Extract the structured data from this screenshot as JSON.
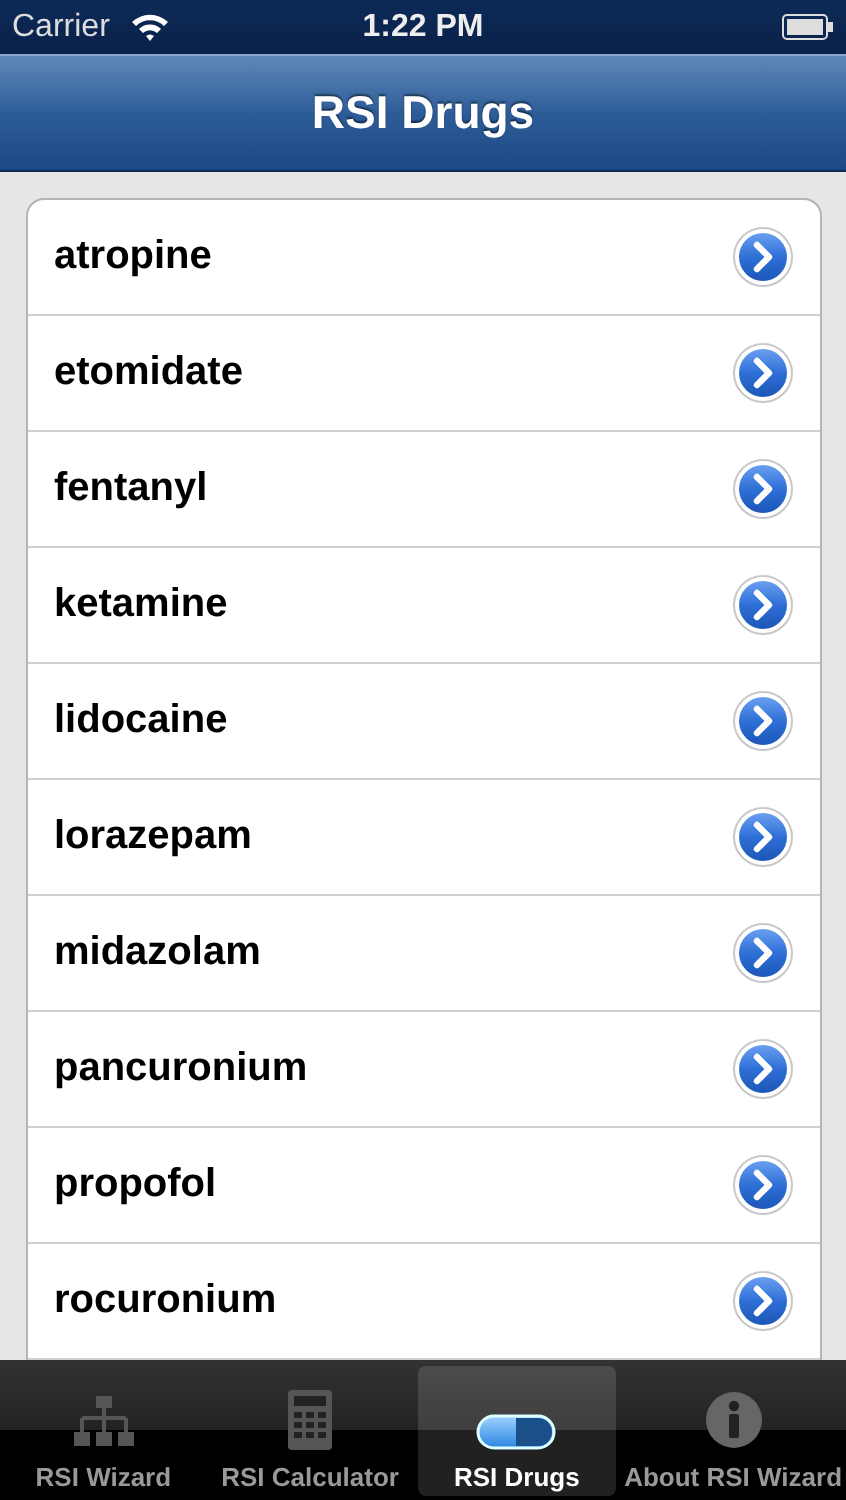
{
  "status_bar": {
    "carrier": "Carrier",
    "time": "1:22 PM"
  },
  "nav_bar": {
    "title": "RSI Drugs"
  },
  "drugs": [
    {
      "name": "atropine"
    },
    {
      "name": "etomidate"
    },
    {
      "name": "fentanyl"
    },
    {
      "name": "ketamine"
    },
    {
      "name": "lidocaine"
    },
    {
      "name": "lorazepam"
    },
    {
      "name": "midazolam"
    },
    {
      "name": "pancuronium"
    },
    {
      "name": "propofol"
    },
    {
      "name": "rocuronium"
    }
  ],
  "tab_bar": [
    {
      "label": "RSI Wizard",
      "kind": "hierarchy",
      "selected": false
    },
    {
      "label": "RSI Calculator",
      "kind": "calculator",
      "selected": false
    },
    {
      "label": "RSI Drugs",
      "kind": "pill",
      "selected": true
    },
    {
      "label": "About RSI Wizard",
      "kind": "info",
      "selected": false
    }
  ]
}
